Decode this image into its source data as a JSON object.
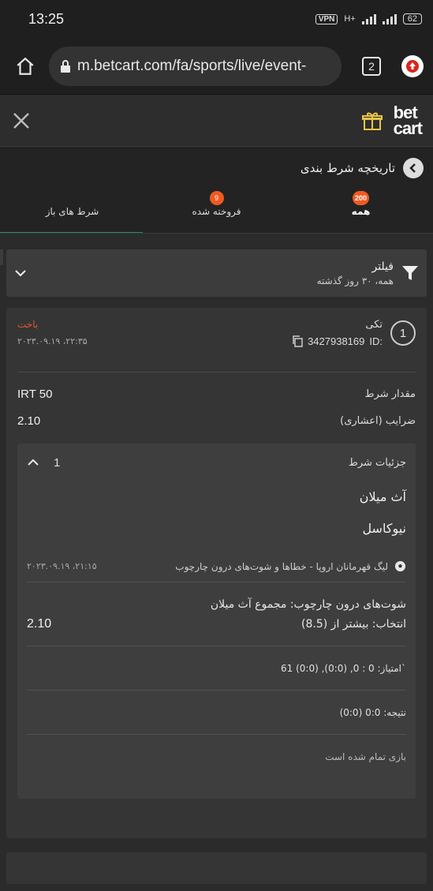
{
  "status": {
    "time": "13:25",
    "vpn": "VPN",
    "network": "H+",
    "battery": "62"
  },
  "browser": {
    "url": "m.betcart.com/fa/sports/live/event-",
    "tab_count": "2"
  },
  "brand": {
    "line1": "bet",
    "line2": "cart"
  },
  "title": "تاریخچه شرط بندی",
  "tabs": [
    {
      "label": "همه",
      "badge": "200"
    },
    {
      "label": "فروخته شده",
      "badge": "9"
    },
    {
      "label": "شرط های باز",
      "badge": ""
    }
  ],
  "filter": {
    "title": "فیلتر",
    "subtitle": "همه، ۳۰ روز گذشته"
  },
  "bet": {
    "number": "1",
    "type": "تکی",
    "id_label": "ID:",
    "id": "3427938169",
    "status": "باخت",
    "datetime": "۲۰۲۳.۰۹.۱۹ ،۲۲:۳۵",
    "stake_label": "مقدار شرط",
    "stake": "IRT 50",
    "odds_label": "ضرایب (اعشاری)",
    "odds": "2.10"
  },
  "details": {
    "title": "جزئیات شرط",
    "count": "1",
    "team1": "آث میلان",
    "team2": "نیوکاسل",
    "league": "لیگ قهرمانان اروپا - خطاها و شوت‌های درون چارچوب",
    "match_datetime": "۲۰۲۳.۰۹.۱۹ ،۲۱:۱۵",
    "market": "شوت‌های درون چارچوب: مجموع آث میلان",
    "selection": "انتخاب: بیشتر از (8.5)",
    "selection_odds": "2.10",
    "score": "امتیاز: 0 : 0, (0:0), (0:0) 61`",
    "result": "نتیجه: 0:0 (0:0)",
    "game_status": "بازی تمام شده است"
  }
}
